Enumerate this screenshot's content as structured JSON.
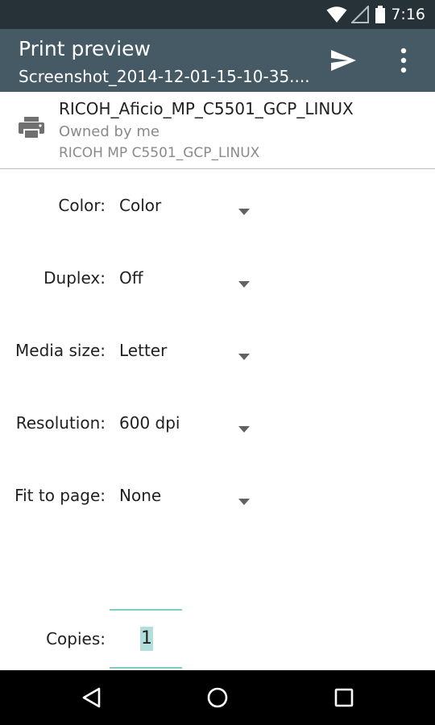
{
  "status_bar": {
    "time": "7:16",
    "icons": [
      "wifi-icon",
      "signal-icon",
      "battery-icon"
    ]
  },
  "app_bar": {
    "title": "Print preview",
    "subtitle": "Screenshot_2014-12-01-15-10-35....",
    "actions": [
      "send-icon",
      "overflow-menu-icon"
    ]
  },
  "printer": {
    "name": "RICOH_Aficio_MP_C5501_GCP_LINUX",
    "owner": "Owned by me",
    "model": "RICOH MP C5501_GCP_LINUX"
  },
  "options": [
    {
      "label": "Color:",
      "value": "Color"
    },
    {
      "label": "Duplex:",
      "value": "Off"
    },
    {
      "label": "Media size:",
      "value": "Letter"
    },
    {
      "label": "Resolution:",
      "value": "600 dpi"
    },
    {
      "label": "Fit to page:",
      "value": "None"
    }
  ],
  "copies": {
    "label": "Copies:",
    "value": "1"
  },
  "colors": {
    "status_bar": "#263238",
    "app_bar": "#455a64",
    "accent": "#80cbc4",
    "selection": "#b2dfdb"
  }
}
